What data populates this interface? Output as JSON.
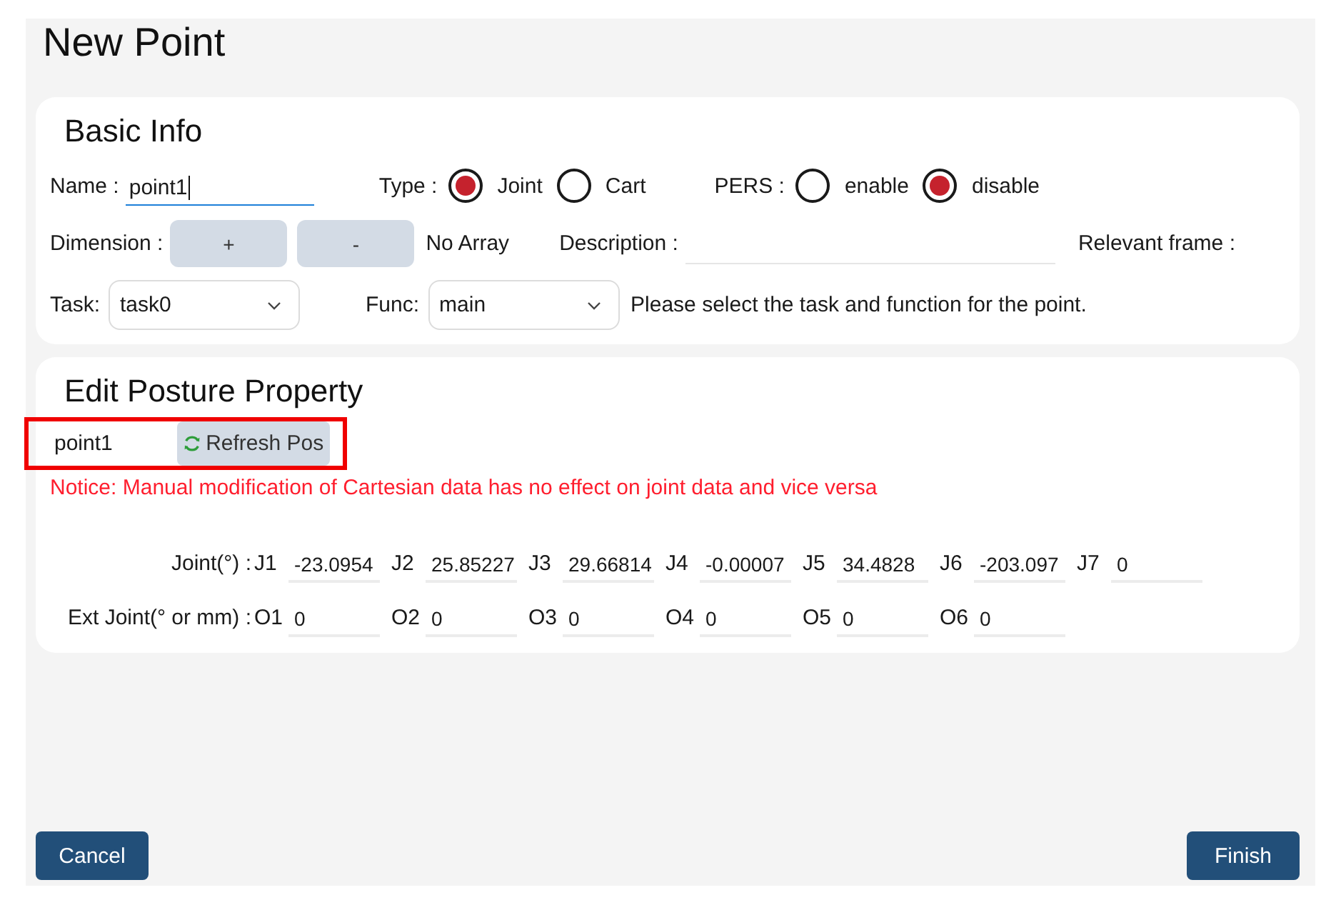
{
  "window": {
    "title": "New Point"
  },
  "basic_info": {
    "title": "Basic Info",
    "name": {
      "label": "Name :",
      "value": "point1",
      "focused": true
    },
    "type": {
      "label": "Type :",
      "options": [
        {
          "label": "Joint",
          "selected": true
        },
        {
          "label": "Cart",
          "selected": false
        }
      ]
    },
    "pers": {
      "label": "PERS :",
      "options": [
        {
          "label": "enable",
          "selected": false
        },
        {
          "label": "disable",
          "selected": true
        }
      ]
    },
    "dimension": {
      "label": "Dimension :",
      "buttons": [
        "+",
        "-"
      ],
      "status": "No Array"
    },
    "description": {
      "label": "Description :"
    },
    "relevant_frame": {
      "label": "Relevant frame :"
    },
    "task": {
      "label": "Task:",
      "value": "task0"
    },
    "func": {
      "label": "Func:",
      "value": "main"
    },
    "hint": "Please select the task and function for the point."
  },
  "posture": {
    "title": "Edit Posture Property",
    "point_name": "point1",
    "highlighted": true,
    "refresh_button": "Refresh Pos",
    "notice": "Notice: Manual modification of Cartesian data has no effect on joint data and vice versa",
    "rows": [
      {
        "label": "Joint(°) :",
        "fields": [
          {
            "label": "J1",
            "value": "-23.0954"
          },
          {
            "label": "J2",
            "value": "25.85227"
          },
          {
            "label": "J3",
            "value": "29.66814"
          },
          {
            "label": "J4",
            "value": "-0.00007"
          },
          {
            "label": "J5",
            "value": "34.4828"
          },
          {
            "label": "J6",
            "value": "-203.097"
          },
          {
            "label": "J7",
            "value": "0"
          }
        ]
      },
      {
        "label": "Ext Joint(° or mm) :",
        "fields": [
          {
            "label": "O1",
            "value": "0"
          },
          {
            "label": "O2",
            "value": "0"
          },
          {
            "label": "O3",
            "value": "0"
          },
          {
            "label": "O4",
            "value": "0"
          },
          {
            "label": "O5",
            "value": "0"
          },
          {
            "label": "O6",
            "value": "0"
          }
        ]
      }
    ]
  },
  "buttons": [
    {
      "label": "Cancel"
    },
    {
      "label": "Finish"
    }
  ]
}
